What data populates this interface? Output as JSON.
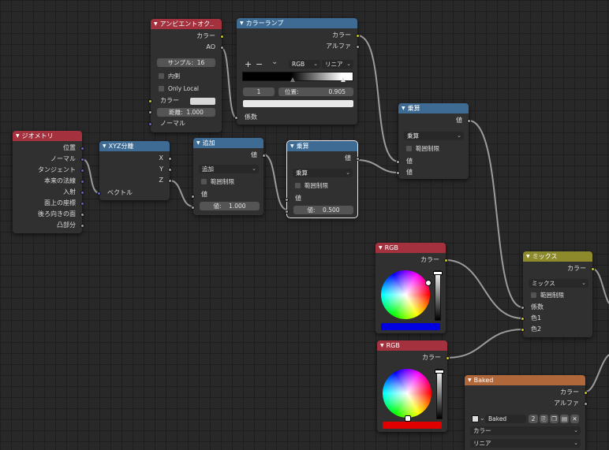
{
  "colors": {
    "wire": "#9b9b9b",
    "socket_color": "#c7c729",
    "socket_float": "#a1a1a1",
    "socket_vector": "#6363c7"
  },
  "ambient_occlusion": {
    "title": "アンビエントオク..",
    "out_color": "カラー",
    "out_ao": "AO",
    "samples": "サンプル:",
    "samples_value": "16",
    "inside": "内側",
    "only_local": "Only Local",
    "in_color": "カラー",
    "distance_label": "距離:",
    "distance_value": "1.000",
    "in_normal": "ノーマル"
  },
  "color_ramp": {
    "title": "カラーランプ",
    "out_color": "カラー",
    "out_alpha": "アルファ",
    "add": "+",
    "remove": "−",
    "menu": "⌄",
    "color_mode": "RGB",
    "interpolation": "リニア",
    "stop_index": "1",
    "position_label": "位置:",
    "position_value": "0.905",
    "in_fac": "係数"
  },
  "geometry": {
    "title": "ジオメトリ",
    "outputs": [
      "位置",
      "ノーマル",
      "タンジェント",
      "本来の法線",
      "入射",
      "面上の座標",
      "後ろ向きの面",
      "凸部分"
    ]
  },
  "separate_xyz": {
    "title": "XYZ分離",
    "outputs": [
      "X",
      "Y",
      "Z"
    ],
    "in_vector": "ベクトル"
  },
  "add_node": {
    "title": "追加",
    "out": "値",
    "operation": "追加",
    "clamp": "範囲制限",
    "in_value": "値",
    "value_label": "値:",
    "value": "1.000"
  },
  "multiply1": {
    "title": "乗算",
    "out": "値",
    "operation": "乗算",
    "clamp": "範囲制限",
    "in_value": "値",
    "value_label": "値:",
    "value": "0.500"
  },
  "multiply2": {
    "title": "乗算",
    "out": "値",
    "operation": "乗算",
    "clamp": "範囲制限",
    "in_value1": "値",
    "in_value2": "値"
  },
  "mix": {
    "title": "ミックス",
    "out": "カラー",
    "blend": "ミックス",
    "clamp": "範囲制限",
    "in_fac": "係数",
    "in_color1": "色1",
    "in_color2": "色2"
  },
  "rgb1": {
    "title": "RGB",
    "out": "カラー",
    "swatch": "#0000e0",
    "value_level": 0.95
  },
  "rgb2": {
    "title": "RGB",
    "out": "カラー",
    "swatch": "#e00000",
    "value_level": 0.95
  },
  "baked": {
    "title": "Baked",
    "out_color": "カラー",
    "out_alpha": "アルファ",
    "image_name": "Baked",
    "users": "2",
    "color_space": "カラー",
    "interpolation": "リニア"
  }
}
